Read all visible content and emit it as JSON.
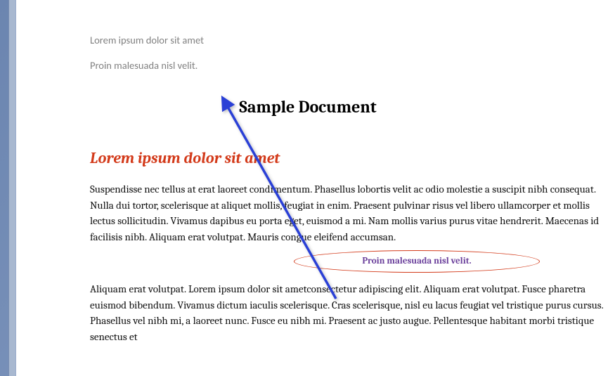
{
  "header": {
    "line1": "Lorem ipsum dolor sit amet",
    "line2": "Proin malesuada nisl velit."
  },
  "title": "Sample Document",
  "heading1": "Lorem ipsum dolor sit amet",
  "para1": "Suspendisse nec tellus at erat laoreet condimentum. Phasellus lobortis velit ac odio molestie a suscipit nibh consequat. Nulla dui tortor, scelerisque at aliquet mollis, feugiat in enim. Praesent  pulvinar risus vel libero ullamcorper et mollis lectus sollicitudin. Vivamus dapibus eu porta eget, euismod a mi. Nam mollis varius purus vitae hendrerit. Maecenas id facilisis  nibh. Aliquam erat volutpat. Mauris congue eleifend  accumsan.",
  "callout": "Proin malesuada nisl velit.",
  "para2": "Aliquam erat volutpat. Lorem ipsum dolor sit ametconsectetur adipiscing elit.  Aliquam erat volutpat. Fusce pharetra euismod bibendum.  Vivamus dictum iaculis scelerisque. Cras scelerisque, nisl eu lacus feugiat vel tristique purus cursus. Phasellus vel nibh mi, a laoreet nunc. Fusce eu nibh mi. Praesent ac justo augue. Pellentesque habitant morbi tristique senectus et",
  "shapes": {
    "arrow_color": "#2a3fd6",
    "ellipse_color": "#d33a1a",
    "callout_text_color": "#6a3f9b"
  }
}
